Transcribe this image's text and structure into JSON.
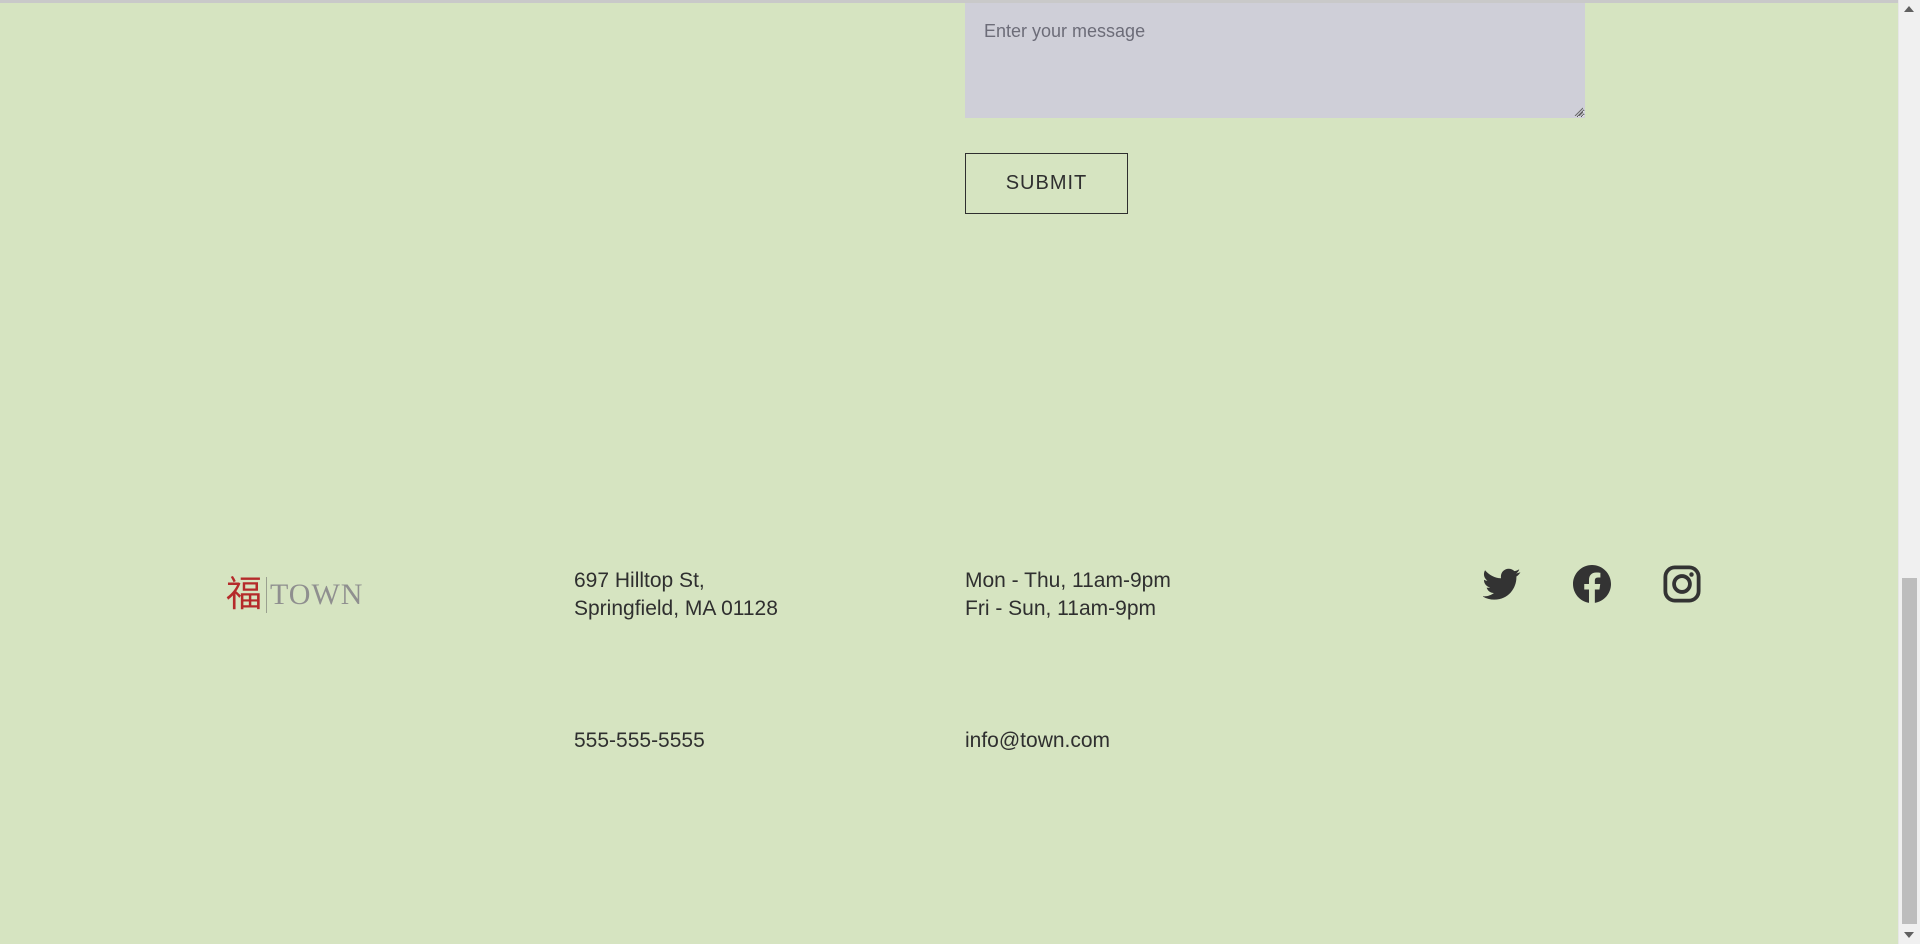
{
  "contact_form": {
    "message_placeholder": "Enter your message",
    "message_value": "",
    "submit_label": "SUBMIT"
  },
  "footer": {
    "logo": {
      "glyph": "福",
      "word": "TOWN"
    },
    "address": {
      "line1": "697 Hilltop St,",
      "line2": "Springfield, MA 01128"
    },
    "hours": {
      "line1": "Mon - Thu, 11am-9pm",
      "line2": "Fri - Sun, 11am-9pm"
    },
    "phone": "555-555-5555",
    "email": "info@town.com",
    "social": [
      "twitter-icon",
      "facebook-icon",
      "instagram-icon"
    ]
  },
  "colors": {
    "background": "#d6e4c1",
    "textarea": "#cfcfd8",
    "text": "#2f2f2f",
    "logo_red": "#b52a2a",
    "logo_gray": "#8f8f8f"
  }
}
